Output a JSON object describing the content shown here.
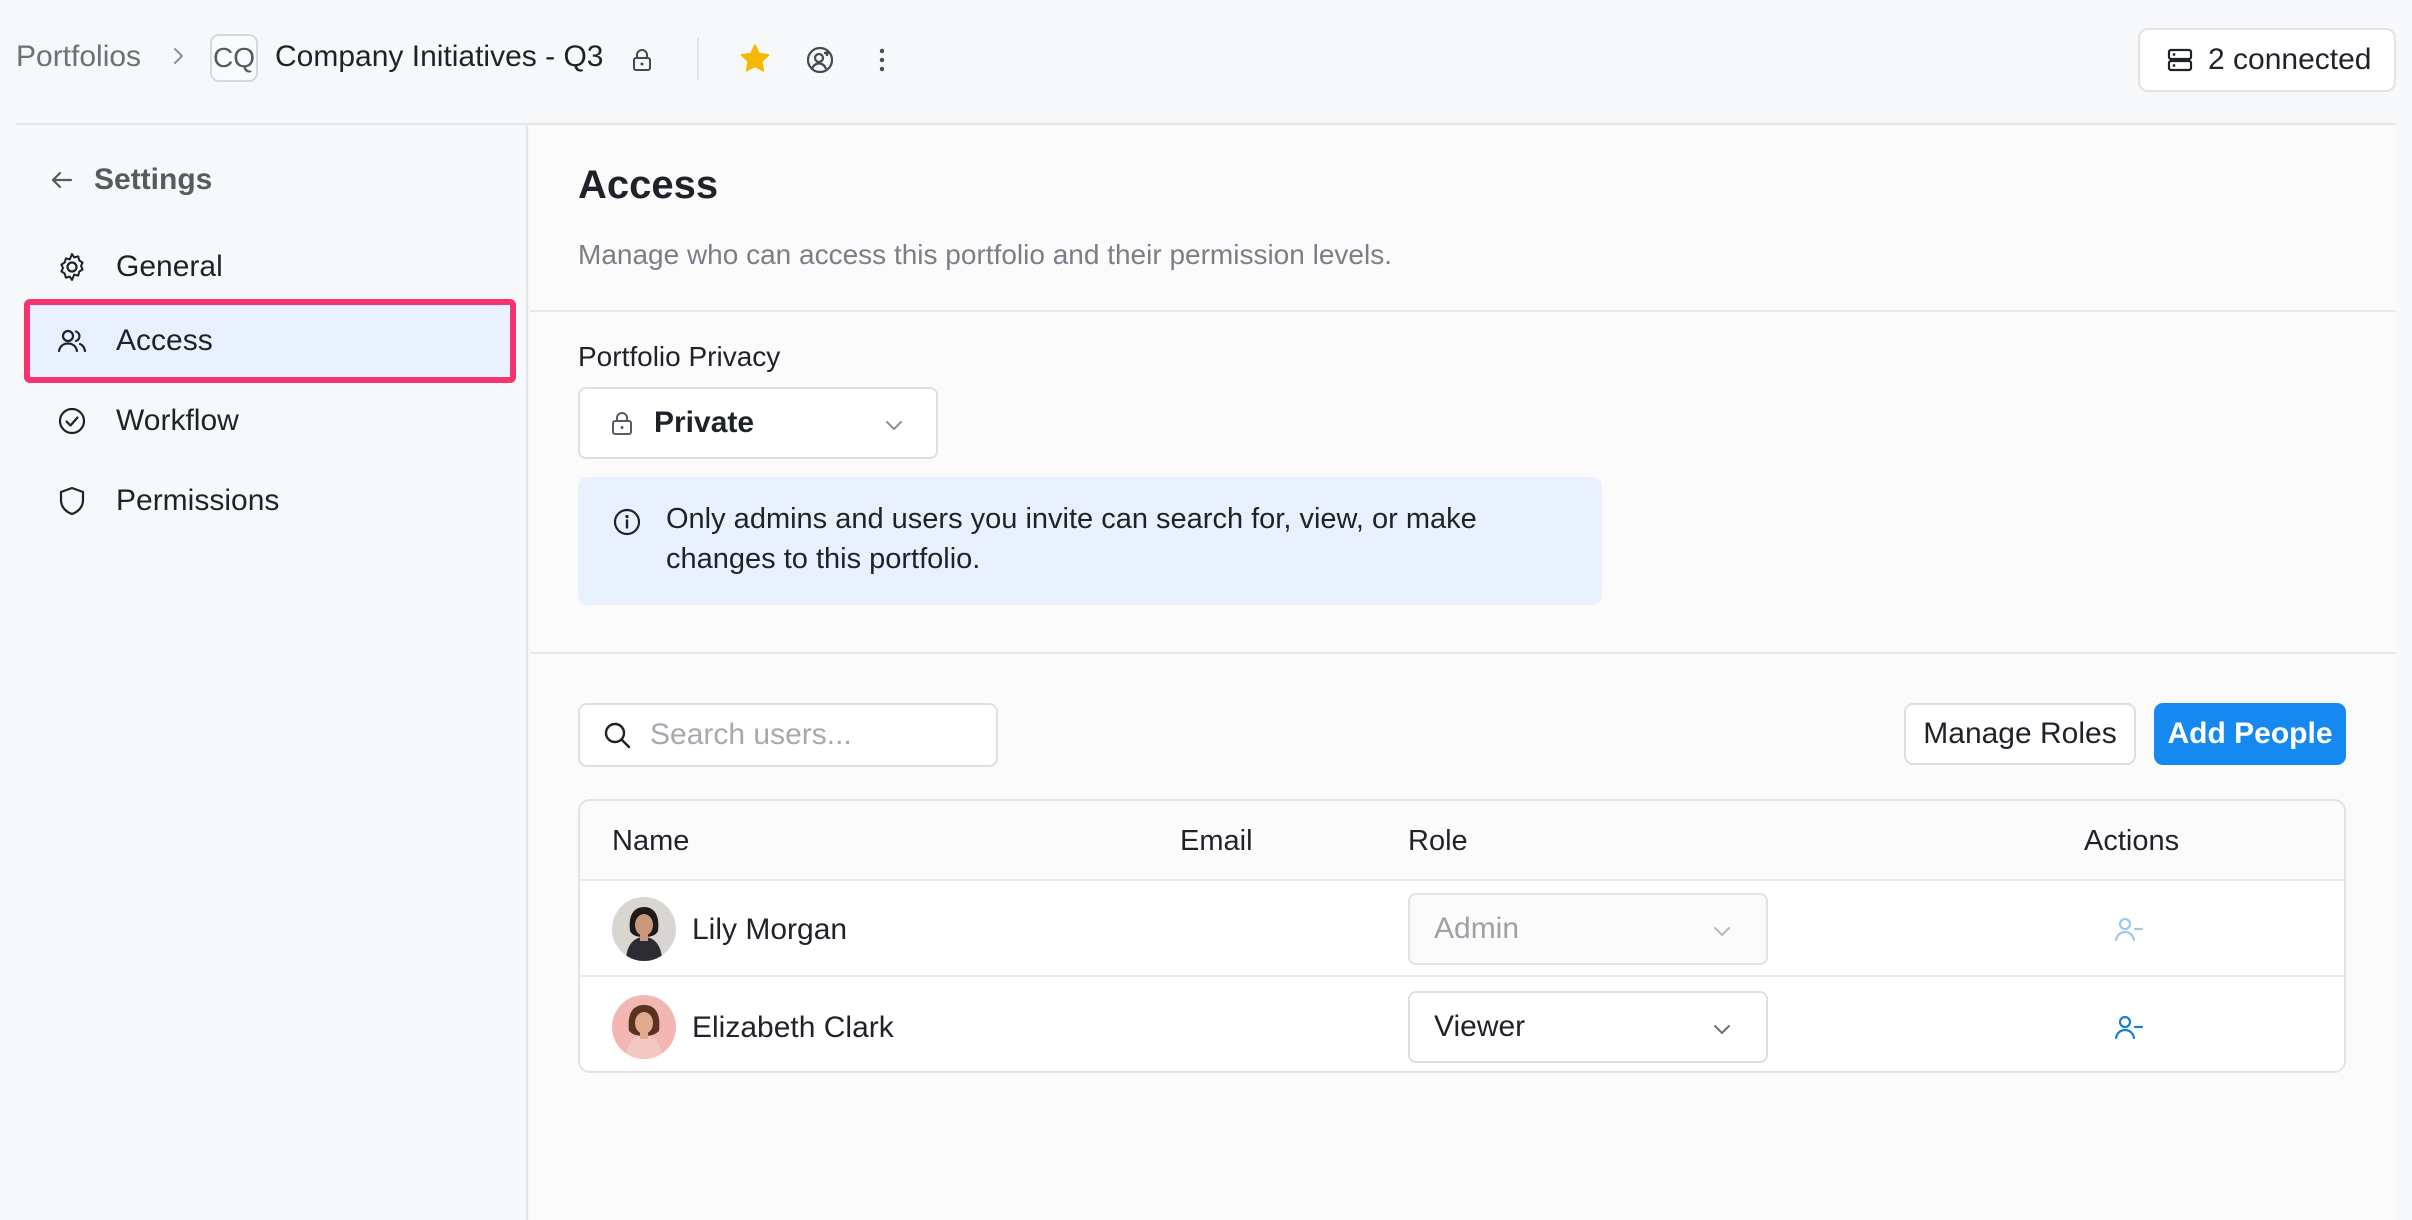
{
  "breadcrumb": {
    "root": "Portfolios",
    "badge": "CQ",
    "title": "Company Initiatives - Q3"
  },
  "topbar": {
    "connected_label": "2 connected"
  },
  "sidebar": {
    "back_label": "Settings",
    "items": [
      {
        "label": "General",
        "icon": "gear-icon"
      },
      {
        "label": "Access",
        "icon": "users-icon",
        "active": true
      },
      {
        "label": "Workflow",
        "icon": "check-circle-icon"
      },
      {
        "label": "Permissions",
        "icon": "shield-icon"
      }
    ]
  },
  "main": {
    "title": "Access",
    "description": "Manage who can access this portfolio and their permission levels.",
    "privacy_label": "Portfolio Privacy",
    "privacy_value": "Private",
    "info_text": "Only admins and users you invite can search for, view, or make changes to this portfolio.",
    "search_placeholder": "Search users...",
    "manage_roles_label": "Manage Roles",
    "add_people_label": "Add People"
  },
  "table": {
    "headers": {
      "name": "Name",
      "email": "Email",
      "role": "Role",
      "actions": "Actions"
    },
    "rows": [
      {
        "name": "Lily Morgan",
        "email": "",
        "role": "Admin",
        "role_disabled": true
      },
      {
        "name": "Elizabeth Clark",
        "email": "",
        "role": "Viewer",
        "role_disabled": false
      }
    ]
  },
  "colors": {
    "accent": "#1589f0",
    "highlight_border": "#f5336d",
    "active_bg": "#e8f1fd",
    "star": "#f5b800"
  }
}
